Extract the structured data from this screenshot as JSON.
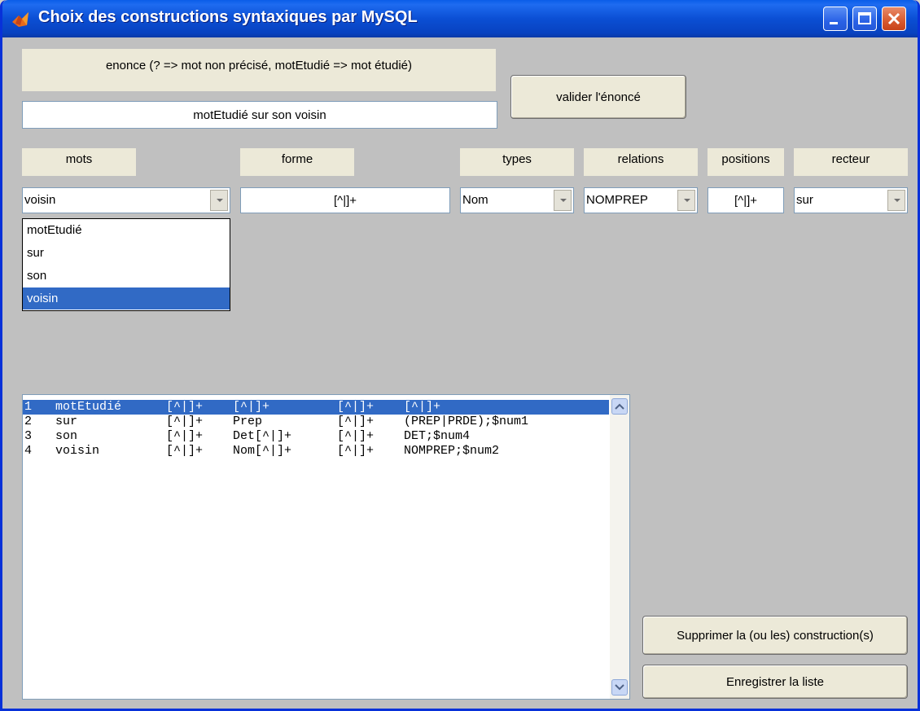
{
  "window": {
    "title": "Choix des constructions syntaxiques par MySQL"
  },
  "statement": {
    "label": "enonce (? => mot non précisé, motEtudié => mot étudié)",
    "value": "motEtudié sur son voisin",
    "validate_button": "valider l'énoncé"
  },
  "columns": {
    "mots": "mots",
    "forme": "forme",
    "types": "types",
    "relations": "relations",
    "positions": "positions",
    "recteur": "recteur"
  },
  "controls": {
    "mots_value": "voisin",
    "forme_value": "[^|]+",
    "types_value": "Nom",
    "relations_value": "NOMPREP",
    "positions_value": "[^|]+",
    "recteur_value": "sur"
  },
  "mots_options": [
    "motEtudié",
    "sur",
    "son",
    "voisin"
  ],
  "list": {
    "rows": [
      [
        "1",
        "motEtudié",
        "[^|]+",
        "[^|]+",
        "[^|]+",
        "[^|]+"
      ],
      [
        "2",
        "sur",
        "[^|]+",
        "Prep",
        "[^|]+",
        "(PREP|PRDE);$num1"
      ],
      [
        "3",
        "son",
        "[^|]+",
        "Det[^|]+",
        "[^|]+",
        "DET;$num4"
      ],
      [
        "4",
        "voisin",
        "[^|]+",
        "Nom[^|]+",
        "[^|]+",
        "NOMPREP;$num2"
      ]
    ]
  },
  "actions": {
    "delete_button": "Supprimer la (ou les) construction(s)",
    "save_button": "Enregistrer la liste"
  },
  "colors": {
    "selection": "#316ac5",
    "titlebar": "#0b4fd4",
    "panel": "#c0c0c0",
    "label_bg": "#ece9d8"
  }
}
